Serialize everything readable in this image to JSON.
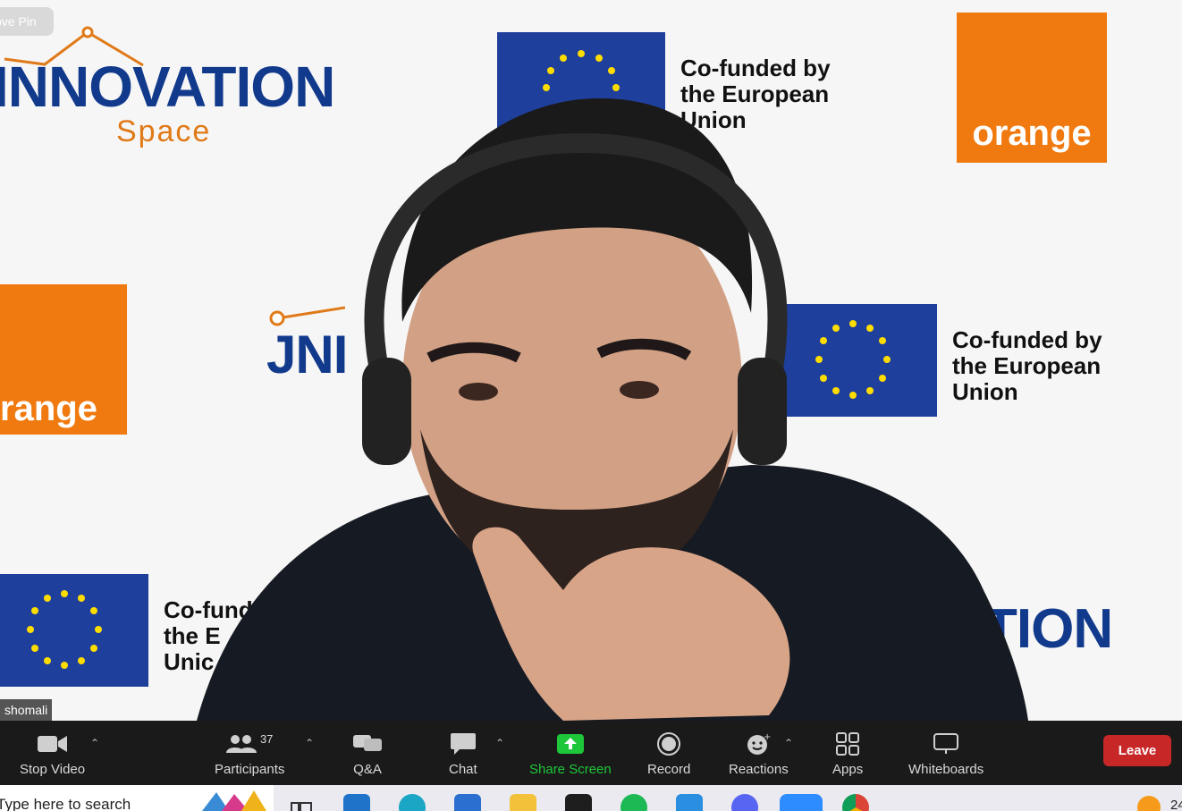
{
  "video": {
    "pin_label": "ove Pin",
    "participant_name": "shomali",
    "backdrop": {
      "innovation_text": "INNOVATION",
      "space_text": "Space",
      "innovation_partial_1": "JNI",
      "innovation_partial_2": "TION",
      "eu_text_line1": "Co-funded by",
      "eu_text_line2": "the European",
      "eu_text_line3": "Union",
      "eu_partial_line1": "Co-fund",
      "eu_partial_line2": "the E",
      "eu_partial_line3": "Unic",
      "orange_text": "orange",
      "orange_partial": "range",
      "colors": {
        "eu_blue": "#1f3f9c",
        "eu_star": "#ffdd00",
        "orange": "#f07a10",
        "innovation_blue": "#123a8c"
      }
    }
  },
  "toolbar": {
    "stop_video": "Stop Video",
    "participants": "Participants",
    "participants_count": "37",
    "qa": "Q&A",
    "chat": "Chat",
    "share_screen": "Share Screen",
    "record": "Record",
    "reactions": "Reactions",
    "apps": "Apps",
    "whiteboards": "Whiteboards",
    "leave": "Leave",
    "colors": {
      "share_green": "#1ec73a",
      "leave_red": "#c72727"
    }
  },
  "taskbar": {
    "search_placeholder": "Type here to search",
    "clock_partial": "24",
    "apps": [
      "task-view",
      "mail",
      "edge",
      "store",
      "file-explorer",
      "figma",
      "spotify",
      "vscode",
      "discord",
      "zoom",
      "chrome"
    ]
  }
}
